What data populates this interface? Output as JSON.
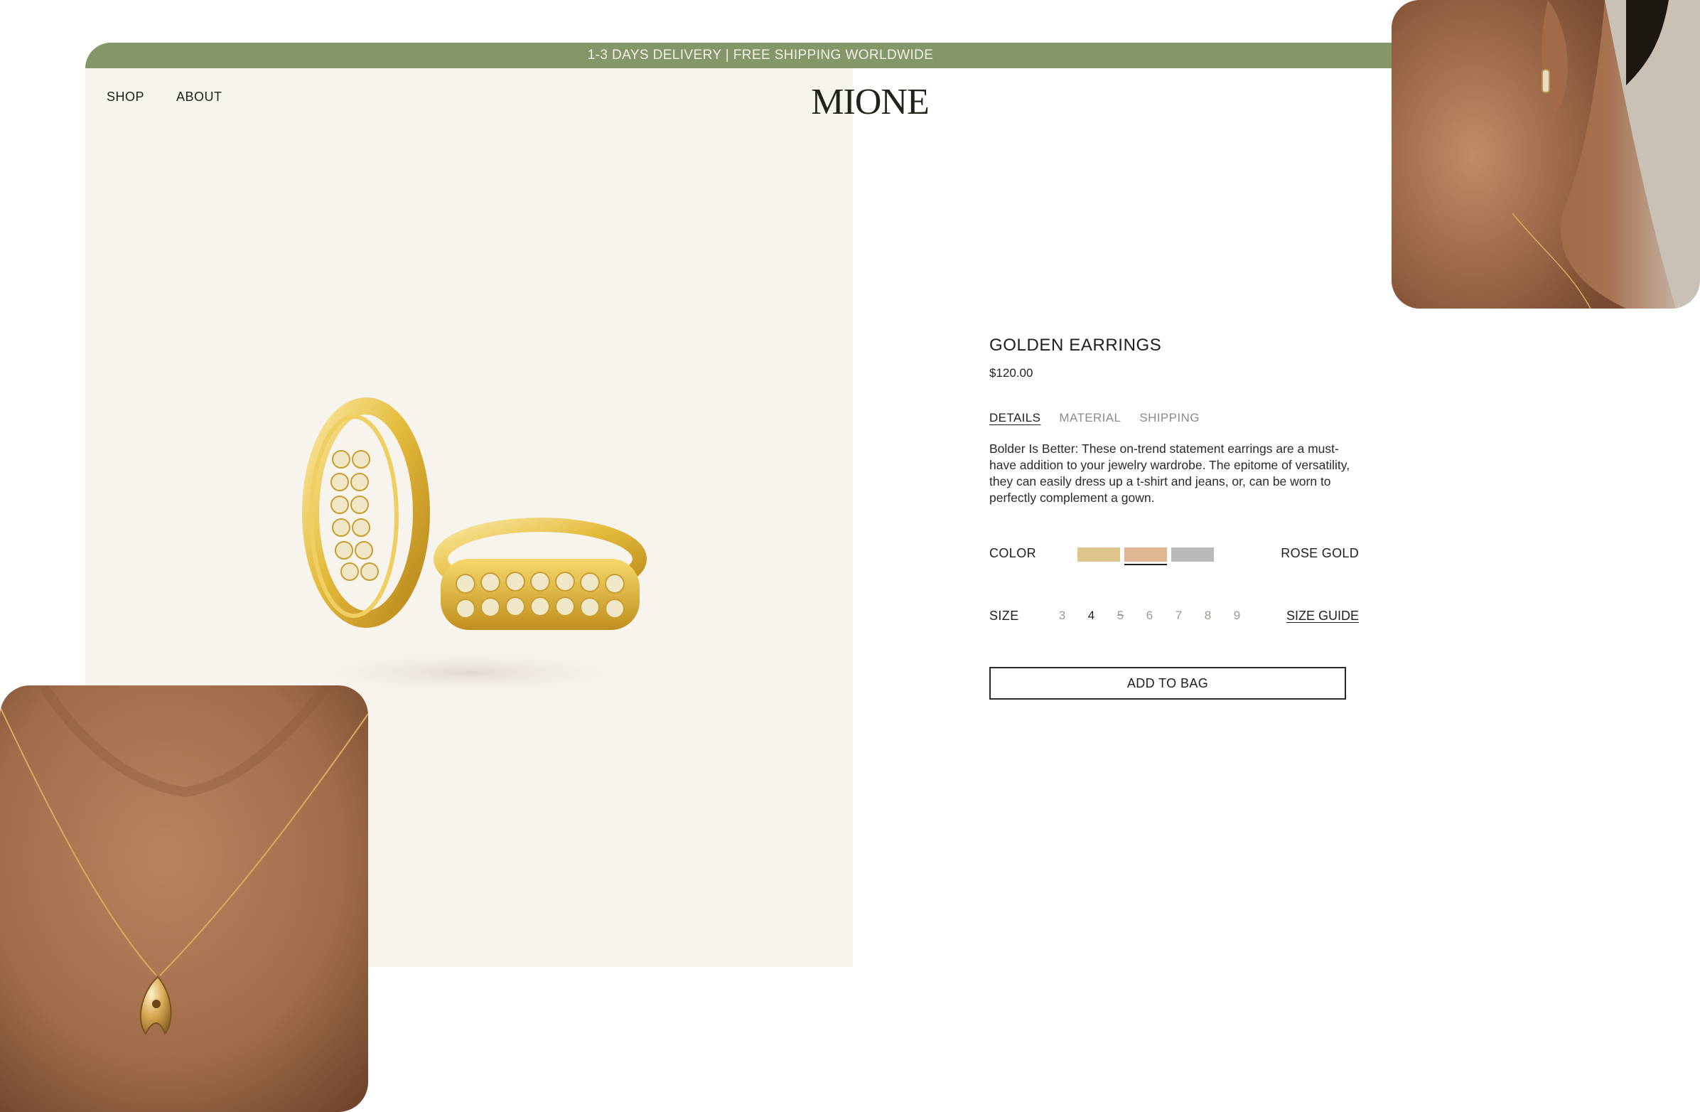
{
  "banner": {
    "text": "1-3 DAYS DELIVERY | FREE SHIPPING WORLDWIDE"
  },
  "nav": {
    "shop": "SHOP",
    "about": "ABOUT"
  },
  "brand": {
    "logo": "MIONE"
  },
  "product": {
    "title": "GOLDEN EARRINGS",
    "price": "$120.00",
    "tabs": [
      "DETAILS",
      "MATERIAL",
      "SHIPPING"
    ],
    "active_tab": "DETAILS",
    "description": "Bolder Is Better: These on-trend statement earrings are a must-have addition to your jewelry wardrobe. The epitome of versatility, they can easily dress up a t-shirt and jeans, or, can be worn to perfectly complement a gown.",
    "color": {
      "label": "COLOR",
      "value": "ROSE GOLD",
      "swatches": [
        "#dfc58c",
        "#dfb893",
        "#b9b9bc"
      ],
      "selected_index": 1
    },
    "size": {
      "label": "SIZE",
      "options": [
        "3",
        "4",
        "5",
        "6",
        "7",
        "8",
        "9"
      ],
      "selected": "4",
      "unavailable": [
        "5"
      ],
      "guide_label": "SIZE GUIDE"
    },
    "add_to_bag": "ADD TO BAG"
  },
  "colors": {
    "banner": "#849769",
    "hero_bg": "#f7f3ed",
    "gold": "#e1b93a",
    "skin": "#b4805d"
  }
}
